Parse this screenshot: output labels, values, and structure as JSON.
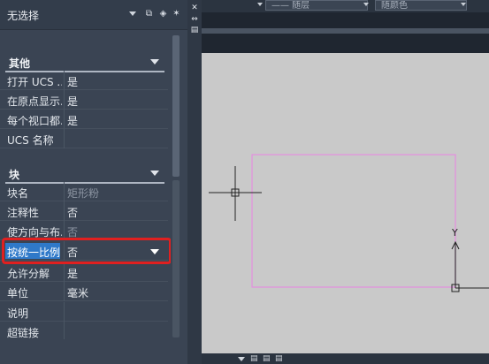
{
  "palette": {
    "selection_label": "无选择",
    "toolbar_icons": [
      "quick-select-icon",
      "select-objects-icon",
      "toggle-pickadd-icon"
    ],
    "side_buttons": [
      "close-icon",
      "autohide-icon",
      "properties-menu-icon"
    ],
    "sections": [
      {
        "title": "其他",
        "rows": [
          {
            "key": "打开 UCS ...",
            "value": "是"
          },
          {
            "key": "在原点显示...",
            "value": "是"
          },
          {
            "key": "每个视口都...",
            "value": "是"
          },
          {
            "key": "UCS 名称",
            "value": ""
          }
        ]
      },
      {
        "title": "块",
        "rows": [
          {
            "key": "块名",
            "value": "矩形粉",
            "dim": true
          },
          {
            "key": "注释性",
            "value": "否"
          },
          {
            "key": "使方向与布...",
            "value": "否",
            "dim": true
          },
          {
            "key": "按统一比例...",
            "value": "否",
            "selected": true
          },
          {
            "key": "允许分解",
            "value": "是"
          },
          {
            "key": "单位",
            "value": "毫米"
          },
          {
            "key": "说明",
            "value": ""
          },
          {
            "key": "超链接",
            "value": ""
          }
        ]
      }
    ]
  },
  "drawing": {
    "top_fields": [
      "—— 随层",
      "随颜色"
    ],
    "ucs_axis_label": "Y",
    "rect_color": "#e48ee0",
    "canvas_color": "#c9c9c9",
    "highlight_color": "#e02020"
  }
}
